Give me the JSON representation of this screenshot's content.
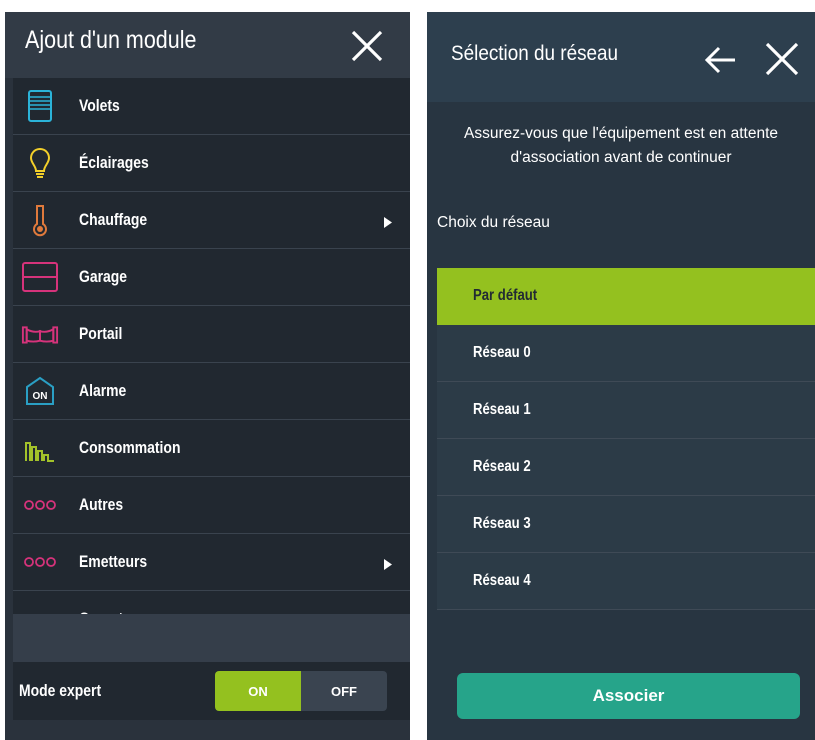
{
  "left": {
    "title": "Ajout d'un module",
    "modules": [
      {
        "label": "Volets",
        "icon": "blind-icon",
        "has_arrow": false
      },
      {
        "label": "Éclairages",
        "icon": "bulb-icon",
        "has_arrow": false
      },
      {
        "label": "Chauffage",
        "icon": "thermometer-icon",
        "has_arrow": true
      },
      {
        "label": "Garage",
        "icon": "garage-icon",
        "has_arrow": false
      },
      {
        "label": "Portail",
        "icon": "gate-icon",
        "has_arrow": false
      },
      {
        "label": "Alarme",
        "icon": "alarm-icon",
        "icon_text": "ON",
        "has_arrow": false
      },
      {
        "label": "Consommation",
        "icon": "consumption-icon",
        "has_arrow": false
      },
      {
        "label": "Autres",
        "icon": "dots-icon",
        "has_arrow": false
      },
      {
        "label": "Emetteurs",
        "icon": "dots-icon",
        "has_arrow": true
      },
      {
        "label": "Compteurs",
        "icon": "dots-icon",
        "has_arrow": false
      }
    ],
    "expert": {
      "label": "Mode expert",
      "on_label": "ON",
      "off_label": "OFF",
      "state": "on"
    }
  },
  "right": {
    "title": "Sélection du réseau",
    "info": "Assurez-vous que l'équipement est en attente d'association avant de continuer",
    "choice_label": "Choix du réseau",
    "networks": [
      {
        "label": "Par défaut",
        "selected": true
      },
      {
        "label": "Réseau 0",
        "selected": false
      },
      {
        "label": "Réseau 1",
        "selected": false
      },
      {
        "label": "Réseau 2",
        "selected": false
      },
      {
        "label": "Réseau 3",
        "selected": false
      },
      {
        "label": "Réseau 4",
        "selected": false
      }
    ],
    "associate_label": "Associer"
  },
  "colors": {
    "accent_green": "#94c11f",
    "button_teal": "#26a48a",
    "blind": "#2bb3d8",
    "bulb": "#f2cf2a",
    "heating": "#e07a3c",
    "pink": "#d6337b",
    "alarm": "#2a9fc4",
    "consumption": "#a3c22a"
  }
}
